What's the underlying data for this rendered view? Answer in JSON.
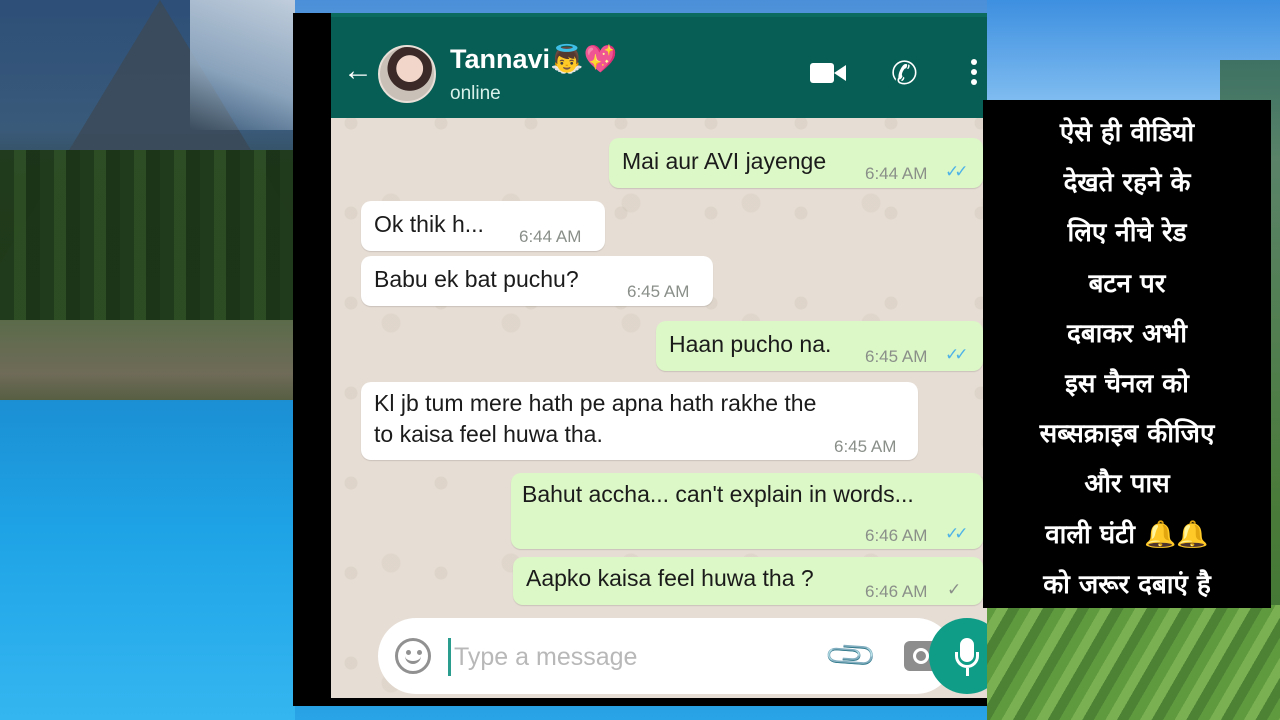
{
  "header": {
    "contact_name": "Tannavi👼💖",
    "status": "online",
    "icons": [
      "back-arrow-icon",
      "video-call-icon",
      "phone-icon",
      "more-menu-icon"
    ]
  },
  "messages": [
    {
      "direction": "out",
      "text": "Mai aur AVI jayenge",
      "time": "6:44 AM",
      "ticks": "✓✓"
    },
    {
      "direction": "in",
      "text": "Ok thik h...",
      "time": "6:44 AM"
    },
    {
      "direction": "in",
      "text": "Babu ek bat puchu?",
      "time": "6:45 AM"
    },
    {
      "direction": "out",
      "text": "Haan pucho na.",
      "time": "6:45 AM",
      "ticks": "✓✓"
    },
    {
      "direction": "in",
      "text_line1": "Kl jb tum mere hath pe apna hath rakhe the",
      "text_line2": "to kaisa feel huwa tha.",
      "time": "6:45 AM"
    },
    {
      "direction": "out",
      "text": "Bahut accha... can't explain in words...",
      "time": "6:46 AM",
      "ticks": "✓✓"
    },
    {
      "direction": "out",
      "text": "Aapko kaisa feel huwa tha ?",
      "time": "6:46 AM",
      "ticks": "✓"
    }
  ],
  "input": {
    "placeholder": "Type a message",
    "icons": [
      "emoji-icon",
      "attach-icon",
      "camera-icon",
      "mic-icon"
    ]
  },
  "caption": {
    "lines": [
      "ऐसे ही वीडियो",
      "देखते रहने के",
      "लिए नीचे रेड",
      "बटन पर",
      "दबाकर अभी",
      "इस चैनल को",
      "सब्सक्राइब कीजिए",
      "और पास",
      "वाली घंटी 🔔🔔",
      "को जरूर दबाएं है"
    ]
  },
  "colors": {
    "header": "#075e54",
    "outgoing_bubble": "#dcf8c6",
    "incoming_bubble": "#ffffff",
    "read_ticks": "#4fb3e8",
    "mic_button": "#0f9d87"
  }
}
